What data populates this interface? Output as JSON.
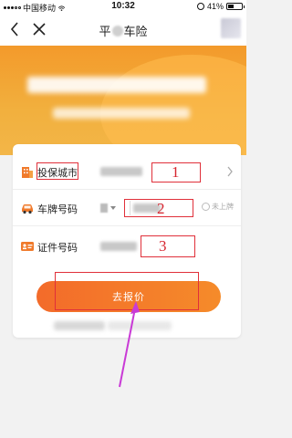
{
  "status_bar": {
    "carrier": "中国移动",
    "time": "10:32",
    "battery": "41%",
    "battery_level": 0.41
  },
  "nav": {
    "title_left": "平",
    "title_right": "车险",
    "back_icon": "chevron-left-icon",
    "close_icon": "close-icon"
  },
  "form": {
    "city_label": "投保城市",
    "plate_label": "车牌号码",
    "unplated_label": "未上牌",
    "id_label": "证件号码",
    "quote_button": "去报价"
  },
  "annotations": [
    "1",
    "2",
    "3"
  ],
  "colors": {
    "accent": "#f36b2a",
    "banner": "#f39a2b",
    "annotation": "#d6252f",
    "pointer": "#c93ad6"
  }
}
